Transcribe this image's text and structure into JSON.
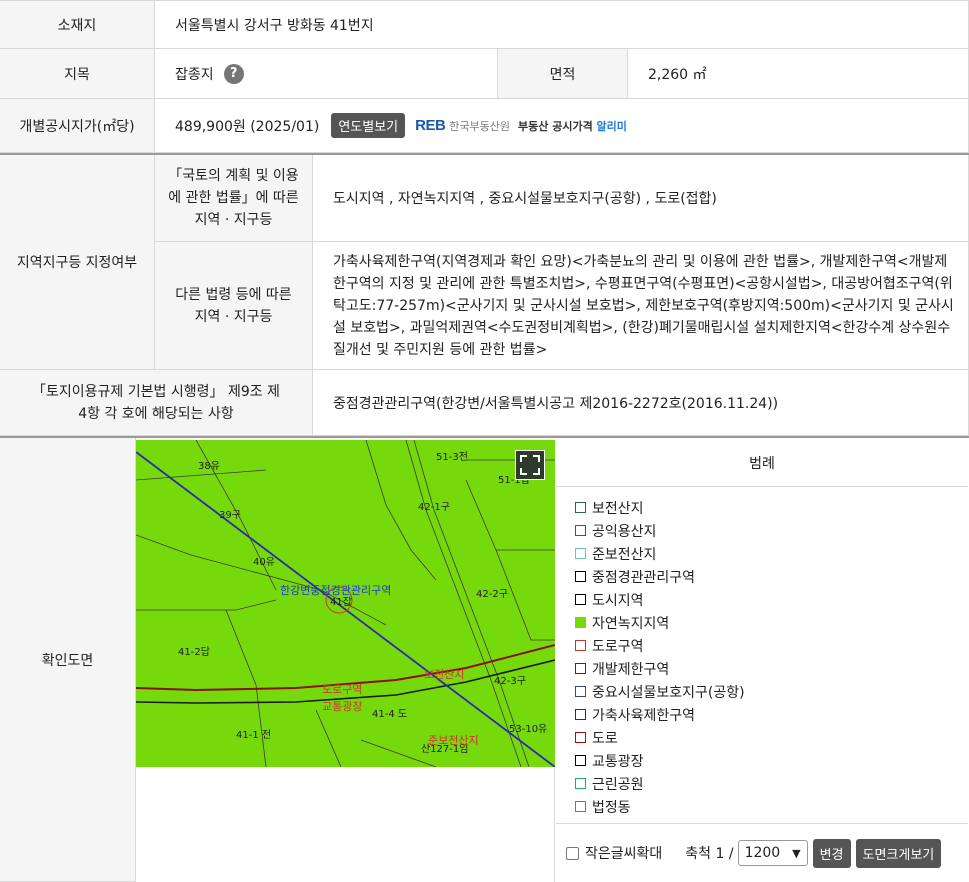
{
  "location": {
    "label": "소재지",
    "value": "서울특별시 강서구 방화동 41번지"
  },
  "land_category": {
    "label": "지목",
    "value": "잡종지",
    "help_glyph": "?"
  },
  "area": {
    "label": "면적",
    "value": "2,260 ㎡"
  },
  "official_price": {
    "label": "개별공시지가(㎡당)",
    "value": "489,900원 (2025/01)",
    "button": "연도별보기",
    "reb_mark": "REB",
    "reb_name": "한국부동산원",
    "reb_service": "부동산 공시가격",
    "reb_service_highlight": "알리미"
  },
  "zoning": {
    "label": "지역지구등 지정여부",
    "national_law_label": "「국토의 계획 및 이용에 관한 법률」에 따른 지역 · 지구등",
    "national_law_value": "도시지역 , 자연녹지지역 , 중요시설물보호지구(공항) , 도로(접합)",
    "other_law_label": "다른 법령 등에 따른 지역 · 지구등",
    "other_law_value": "가축사육제한구역(지역경제과 확인 요망)<가축분뇨의 관리 및 이용에 관한 법률>, 개발제한구역<개발제한구역의 지정 및 관리에 관한 특별조치법>, 수평표면구역(수평표면)<공항시설법>, 대공방어협조구역(위탁고도:77-257m)<군사기지 및 군사시설 보호법>, 제한보호구역(후방지역:500m)<군사기지 및 군사시설 보호법>, 과밀억제권역<수도권정비계획법>, (한강)폐기물매립시설 설치제한지역<한강수계 상수원수질개선 및 주민지원 등에 관한 법률>"
  },
  "enforcement": {
    "label": "「토지이용규제 기본법 시행령」 제9조 제4항 각 호에 해당되는 사항",
    "value": "중점경관관리구역(한강변/서울특별시공고 제2016-2272호(2016.11.24))"
  },
  "map_section": {
    "label": "확인도면",
    "parcel_labels": [
      "38유",
      "39구",
      "40유",
      "41잡",
      "41-2답",
      "41-1 전",
      "41-4 도",
      "42-1구",
      "42-2구",
      "42-3구",
      "51-3전",
      "51-1답",
      "53-10유",
      "산127-1임"
    ],
    "overlay_labels": [
      "한강변중점경관관리구역",
      "도로구역",
      "교통광장",
      "보전산지",
      "준보전산지"
    ]
  },
  "legend": {
    "title": "범례",
    "items": [
      {
        "label": "보전산지",
        "color": "#1f6b4a",
        "fill": "#ffffff"
      },
      {
        "label": "공익용산지",
        "color": "#1f6b4a",
        "fill": "#ffffff"
      },
      {
        "label": "준보전산지",
        "color": "#67c7c0",
        "fill": "#ffffff"
      },
      {
        "label": "중점경관관리구역",
        "color": "#000000",
        "fill": "#ffffff"
      },
      {
        "label": "도시지역",
        "color": "#000000",
        "fill": "#ffffff"
      },
      {
        "label": "자연녹지지역",
        "color": "#76d90b",
        "fill": "#76d90b"
      },
      {
        "label": "도로구역",
        "color": "#c0392b",
        "fill": "#ffffff"
      },
      {
        "label": "개발제한구역",
        "color": "#2a2a8c",
        "fill": "#ffffff"
      },
      {
        "label": "중요시설물보호지구(공항)",
        "color": "#2f4a8c",
        "fill": "#ffffff"
      },
      {
        "label": "가축사육제한구역",
        "color": "#333333",
        "fill": "#ffffff"
      },
      {
        "label": "도로",
        "color": "#a01010",
        "fill": "#ffffff"
      },
      {
        "label": "교통광장",
        "color": "#000000",
        "fill": "#ffffff"
      },
      {
        "label": "근린공원",
        "color": "#27ae60",
        "fill": "#ffffff"
      },
      {
        "label": "법정동",
        "color": "#6a8a3a",
        "fill": "#ffffff"
      }
    ]
  },
  "controls": {
    "enlarge_text_label": "작은글씨확대",
    "scale_label": "축척 1 /",
    "scale_value": "1200",
    "change_button": "변경",
    "large_map_button": "도면크게보기"
  }
}
